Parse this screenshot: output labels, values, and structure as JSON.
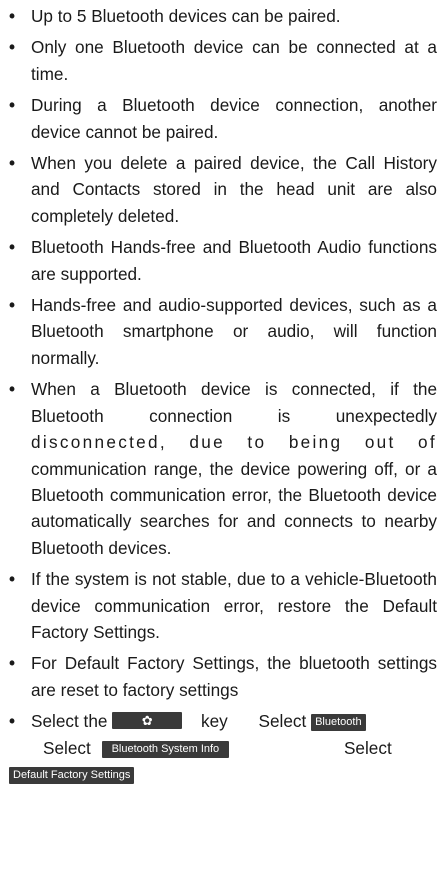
{
  "bullet": "•",
  "items": [
    "Up to 5 Bluetooth devices can be paired.",
    "Only one Bluetooth device can be connected at a time.",
    "During a Bluetooth device connection, another device cannot be paired.",
    "When you delete a paired device, the Call History and Contacts stored in the head unit are also completely deleted.",
    "Bluetooth Hands-free and Bluetooth Audio functions are supported.",
    "Hands-free and audio-supported devices, such as a Bluetooth smartphone or audio, will function normally.",
    "When a Bluetooth device is connected, if the Bluetooth connection is unexpectedly",
    "disconnected, due to being out of",
    "communication range, the device powering off, or a Bluetooth communication error, the Bluetooth device automatically searches for and connects to nearby Bluetooth devices.",
    "If the system is not stable, due to a vehicle-Bluetooth device communication error, restore the Default Factory Settings.",
    "For Default Factory Settings, the bluetooth settings are reset to factory settings"
  ],
  "last_item": {
    "select_the": "Select the",
    "gear_icon": "gear-icon",
    "gear_glyph": "✿",
    "key": "key",
    "select": "Select",
    "btn_bluetooth": "Bluetooth",
    "btn_system_info": "Bluetooth System Info",
    "btn_factory": "Default Factory Settings"
  }
}
